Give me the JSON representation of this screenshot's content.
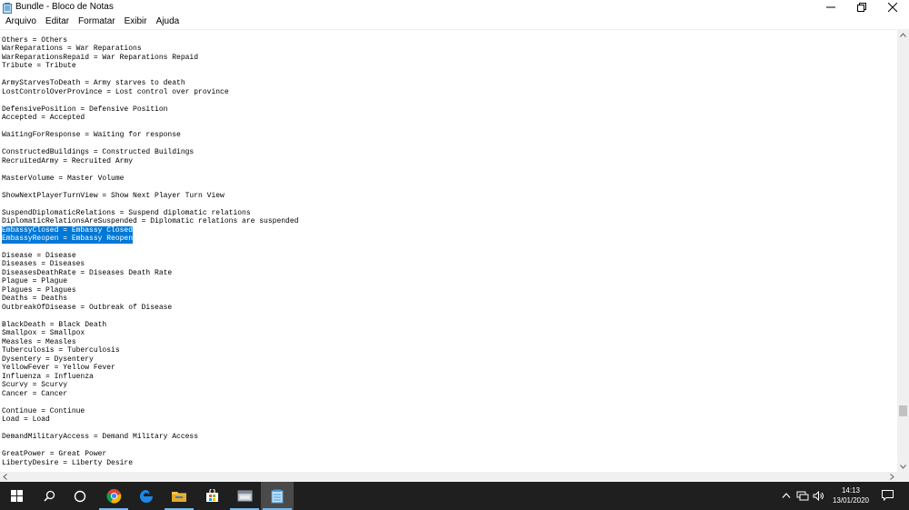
{
  "window": {
    "title": "Bundle - Bloco de Notas",
    "controls": {
      "minimize": "minimize",
      "maximize": "restore",
      "close": "close"
    }
  },
  "menu": [
    "Arquivo",
    "Editar",
    "Formatar",
    "Exibir",
    "Ajuda"
  ],
  "editor": {
    "lines": [
      "Others = Others",
      "WarReparations = War Reparations",
      "WarReparationsRepaid = War Reparations Repaid",
      "Tribute = Tribute",
      "",
      "ArmyStarvesToDeath = Army starves to death",
      "LostControlOverProvince = Lost control over province",
      "",
      "DefensivePosition = Defensive Position",
      "Accepted = Accepted",
      "",
      "WaitingForResponse = Waiting for response",
      "",
      "ConstructedBuildings = Constructed Buildings",
      "RecruitedArmy = Recruited Army",
      "",
      "MasterVolume = Master Volume",
      "",
      "ShowNextPlayerTurnView = Show Next Player Turn View",
      "",
      "SuspendDiplomaticRelations = Suspend diplomatic relations",
      "DiplomaticRelationsAreSuspended = Diplomatic relations are suspended",
      "EmbassyClosed = Embassy Closed",
      "EmbassyReopen = Embassy Reopen",
      "",
      "Disease = Disease",
      "Diseases = Diseases",
      "DiseasesDeathRate = Diseases Death Rate",
      "Plague = Plague",
      "Plagues = Plagues",
      "Deaths = Deaths",
      "OutbreakOfDisease = Outbreak of Disease",
      "",
      "BlackDeath = Black Death",
      "Smallpox = Smallpox",
      "Measles = Measles",
      "Tuberculosis = Tuberculosis",
      "Dysentery = Dysentery",
      "YellowFever = Yellow Fever",
      "Influenza = Influenza",
      "Scurvy = Scurvy",
      "Cancer = Cancer",
      "",
      "Continue = Continue",
      "Load = Load",
      "",
      "DemandMilitaryAccess = Demand Military Access",
      "",
      "GreatPower = Great Power",
      "LibertyDesire = Liberty Desire"
    ],
    "selected_lines": [
      22,
      23
    ],
    "selection_color": "#0078d7"
  },
  "taskbar": {
    "apps": [
      "windows-start",
      "search",
      "task-view",
      "chrome",
      "edge",
      "file-explorer",
      "store",
      "app",
      "notepad"
    ],
    "active_app": "notepad",
    "tray": [
      "chevron-up",
      "network",
      "volume"
    ],
    "time": "14:13",
    "date": "13/01/2020"
  }
}
